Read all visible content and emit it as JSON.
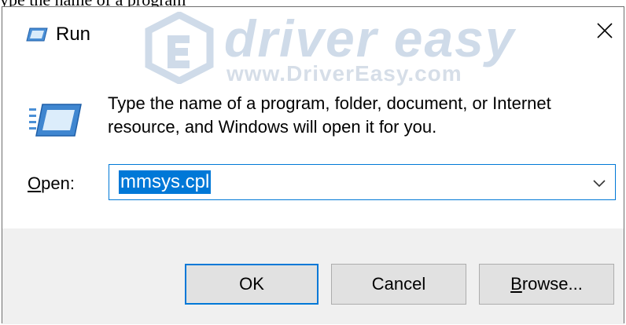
{
  "page_header": {
    "partial_text": "ype the name of a program"
  },
  "window": {
    "title": "Run",
    "close_glyph": "✕"
  },
  "watermark": {
    "brand": "driver easy",
    "url": "www.DriverEasy.com"
  },
  "main": {
    "description": "Type the name of a program, folder, document, or Internet resource, and Windows will open it for you."
  },
  "open_field": {
    "label_accesskey": "O",
    "label_rest": "pen:",
    "value": "mmsys.cpl",
    "selected": true
  },
  "buttons": {
    "ok": "OK",
    "cancel": "Cancel",
    "browse_accesskey": "B",
    "browse_rest": "rowse..."
  },
  "icons": {
    "title": "run-icon",
    "content": "run-icon",
    "close": "close-icon",
    "dropdown": "chevron-down-icon"
  },
  "colors": {
    "accent": "#0078d7",
    "footer_bg": "#f0f0f0",
    "button_bg": "#e1e1e1",
    "watermark": "#cfdbe9"
  }
}
